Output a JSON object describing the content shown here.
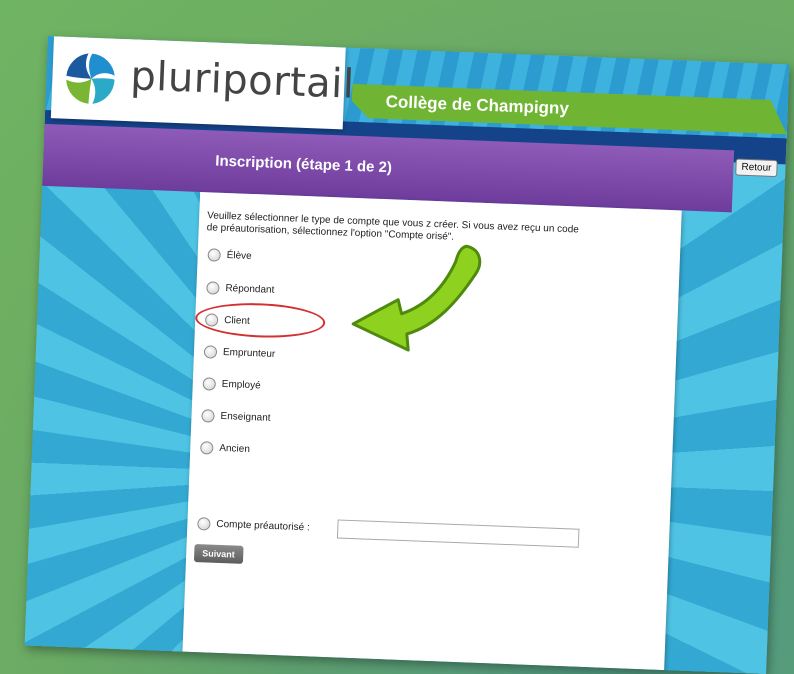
{
  "header": {
    "logo_text": "pluriportail",
    "school_name": "Collège de Champigny",
    "back_button": "Retour"
  },
  "page": {
    "title": "Inscription (étape 1 de 2)",
    "intro_line1": "Veuillez sélectionner le type de compte que vous z créer. Si vous avez reçu un code",
    "intro_line2": "de préautorisation, sélectionnez l'option \"Compte orisé\"."
  },
  "options": [
    {
      "label": "Élève"
    },
    {
      "label": "Répondant"
    },
    {
      "label": "Client"
    },
    {
      "label": "Emprunteur"
    },
    {
      "label": "Employé"
    },
    {
      "label": "Enseignant"
    },
    {
      "label": "Ancien"
    },
    {
      "label": "Compte préautorisé :"
    }
  ],
  "submit_label": "Suivant",
  "colors": {
    "ribbon": "#6fb432",
    "header_purple": "#7e4aa9",
    "highlight_circle": "#d43030",
    "arrow": "#8ed21f"
  }
}
